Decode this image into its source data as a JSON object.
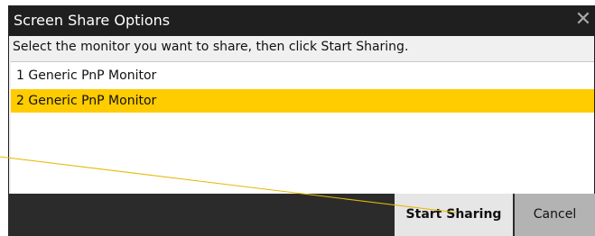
{
  "window": {
    "title": "Screen Share Options",
    "close_icon": "close-icon",
    "close_glyph": "✕"
  },
  "instruction": "Select the monitor you want to share, then click Start Sharing.",
  "monitors": [
    {
      "label": "1 Generic PnP Monitor",
      "selected": false
    },
    {
      "label": "2 Generic PnP Monitor",
      "selected": true
    }
  ],
  "buttons": {
    "start": "Start Sharing",
    "cancel": "Cancel"
  },
  "colors": {
    "selection": "#ffcc00",
    "title_bar": "#1f1f1f",
    "pointer_line": "#e8b800"
  }
}
